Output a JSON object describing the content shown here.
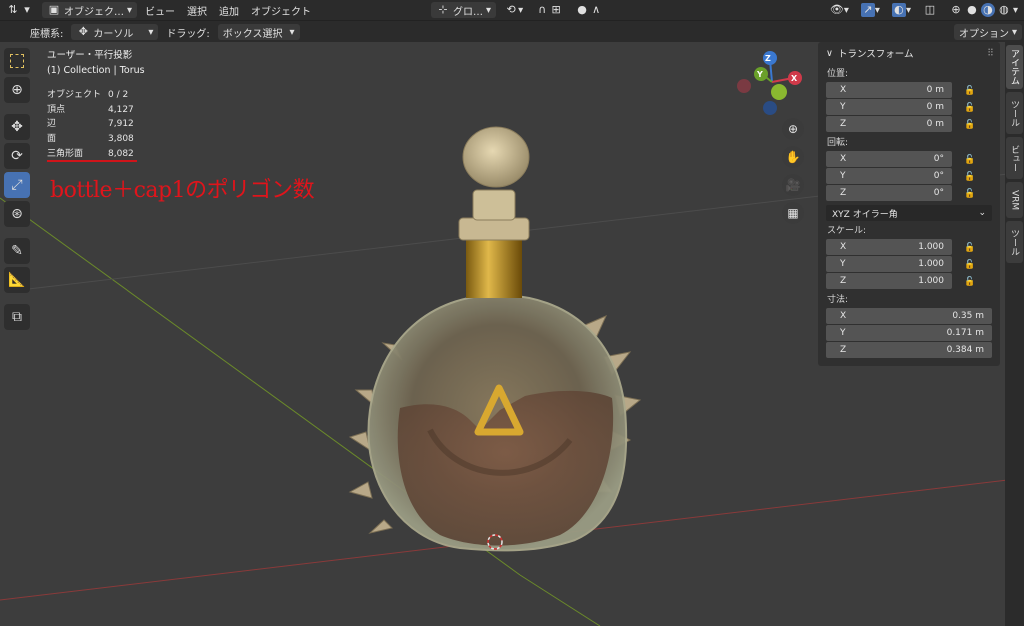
{
  "header": {
    "editor_type_icon": "axis-icon",
    "mode_label": "オブジェク…",
    "menus": [
      "ビュー",
      "選択",
      "追加",
      "オブジェクト"
    ],
    "transform_orientation": "グロ…",
    "options_label": "オプション"
  },
  "subheader": {
    "coord_label": "座標系:",
    "coord_value": "カーソル",
    "drag_label": "ドラッグ:",
    "drag_value": "ボックス選択"
  },
  "viewport_info": {
    "view_name": "ユーザー・平行投影",
    "collection": "(1) Collection | Torus"
  },
  "stats": [
    {
      "label": "オブジェクト",
      "value": "0 / 2"
    },
    {
      "label": "頂点",
      "value": "4,127"
    },
    {
      "label": "辺",
      "value": "7,912"
    },
    {
      "label": "面",
      "value": "3,808"
    },
    {
      "label": "三角形面",
      "value": "8,082"
    }
  ],
  "annotation": {
    "text": "bottle＋cap1のポリゴン数",
    "color": "#e0141b"
  },
  "gizmo": {
    "x_label": "X",
    "y_label": "Y",
    "z_label": "Z"
  },
  "npanel": {
    "title": "トランスフォーム",
    "location_label": "位置:",
    "location": [
      {
        "axis": "X",
        "value": "0 m"
      },
      {
        "axis": "Y",
        "value": "0 m"
      },
      {
        "axis": "Z",
        "value": "0 m"
      }
    ],
    "rotation_label": "回転:",
    "rotation": [
      {
        "axis": "X",
        "value": "0°"
      },
      {
        "axis": "Y",
        "value": "0°"
      },
      {
        "axis": "Z",
        "value": "0°"
      }
    ],
    "rotation_mode": "XYZ オイラー角",
    "scale_label": "スケール:",
    "scale": [
      {
        "axis": "X",
        "value": "1.000"
      },
      {
        "axis": "Y",
        "value": "1.000"
      },
      {
        "axis": "Z",
        "value": "1.000"
      }
    ],
    "dimensions_label": "寸法:",
    "dimensions": [
      {
        "axis": "X",
        "value": "0.35 m"
      },
      {
        "axis": "Y",
        "value": "0.171 m"
      },
      {
        "axis": "Z",
        "value": "0.384 m"
      }
    ]
  },
  "side_tabs": [
    "アイテム",
    "ツール",
    "ビュー",
    "VRM",
    "ツール"
  ]
}
